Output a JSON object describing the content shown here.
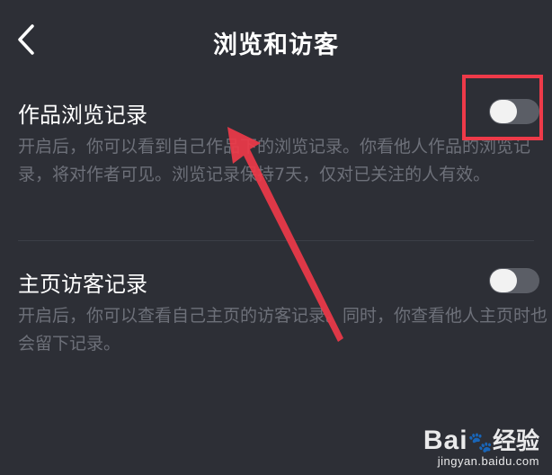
{
  "header": {
    "title": "浏览和访客",
    "back_icon": "chevron-left-icon"
  },
  "settings": [
    {
      "title": "作品浏览记录",
      "description": "开启后，你可以看到自己作品下的浏览记录。你看他人作品的浏览记录，将对作者可见。浏览记录保持7天，仅对已关注的人有效。",
      "enabled": false
    },
    {
      "title": "主页访客记录",
      "description": "开启后，你可以查看自己主页的访客记录。同时，你查看他人主页时也会留下记录。",
      "enabled": false
    }
  ],
  "annotation": {
    "box_color": "#ee3a49",
    "arrow_color": "#ee3a49"
  },
  "watermark": {
    "logo_left": "Bai",
    "logo_right": "经验",
    "url": "jingyan.baidu.com"
  },
  "colors": {
    "background": "#2d2f36",
    "title_text": "#ffffff",
    "description_text": "#6d7079",
    "toggle_track_off": "#5b5e66",
    "toggle_knob": "#f2f2f2"
  }
}
